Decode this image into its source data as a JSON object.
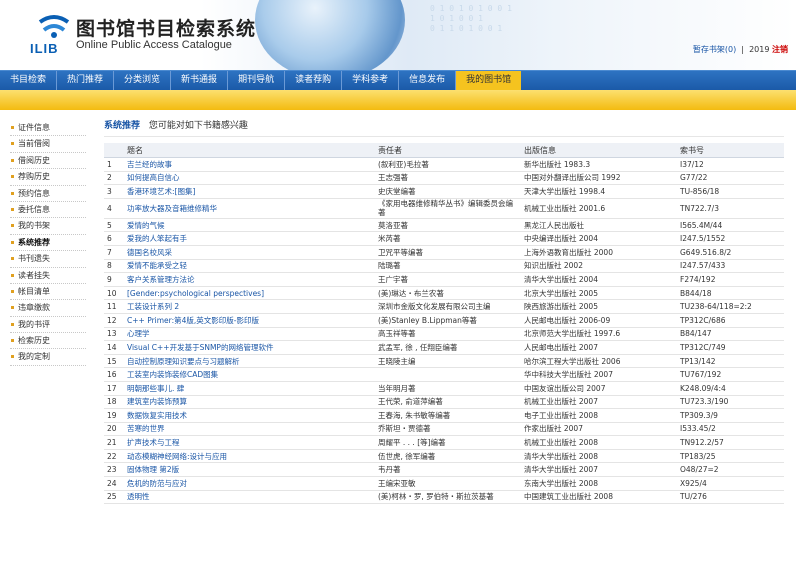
{
  "header": {
    "title_zh": "图书馆书目检索系统",
    "title_en": "Online Public Access Catalogue",
    "logo_text": "ILIB",
    "binary_text": "0 1 0 1 0 1 0 0 1\n1 0 1 0 0 1\n0 1 1 0 1 0 0 1",
    "shelf_label": "暂存书架",
    "shelf_count": "(0)",
    "user_id": "2019",
    "logout_label": "注销"
  },
  "nav": {
    "items": [
      "书目检索",
      "热门推荐",
      "分类浏览",
      "新书通报",
      "期刊导航",
      "读者荐购",
      "学科参考",
      "信息发布",
      "我的图书馆"
    ]
  },
  "sidebar": {
    "items": [
      "证件信息",
      "当前借阅",
      "借阅历史",
      "荐购历史",
      "预约信息",
      "委托信息",
      "我的书架",
      "系统推荐",
      "书刊遗失",
      "读者挂失",
      "帐目清单",
      "违章缴款",
      "我的书评",
      "检索历史",
      "我的定制"
    ],
    "active_index": 7
  },
  "main": {
    "heading": "系统推荐",
    "subheading": "您可能对如下书籍感兴趣"
  },
  "table": {
    "headers": [
      "",
      "题名",
      "责任者",
      "出版信息",
      "索书号"
    ],
    "rows": [
      [
        "1",
        "吉兰经的故事",
        "(叙利亚)毛拉著",
        "新华出版社 1983.3",
        "I37/12"
      ],
      [
        "2",
        "如何提高自信心",
        "王志强著",
        "中国对外翻译出版公司 1992",
        "G77/22"
      ],
      [
        "3",
        "香港环境艺术:[图集]",
        "史庆堂编著",
        "天津大学出版社 1998.4",
        "TU-856/18"
      ],
      [
        "4",
        "功率放大器及音箱维修精华",
        "《家用电器维修精华丛书》编辑委员会编著",
        "机械工业出版社 2001.6",
        "TN722.7/3"
      ],
      [
        "5",
        "爱情的气候",
        "莫洛亚著",
        "黑龙江人民出版社",
        "I565.4M/44"
      ],
      [
        "6",
        "爱我的人笨起有手",
        "米芮著",
        "中央编译出版社 2004",
        "I247.5/1552"
      ],
      [
        "7",
        "德国名校风采",
        "卫咒平等编著",
        "上海外语教育出版社 2000",
        "G649.516.8/2"
      ],
      [
        "8",
        "爱情不能承受之轻",
        "陆璐著",
        "知识出版社 2002",
        "I247.57/433"
      ],
      [
        "9",
        "客户关系管理方法论",
        "王广宇著",
        "清华大学出版社 2004",
        "F274/192"
      ],
      [
        "10",
        "[Gender:psychological perspectives]",
        "(美)琳达・布兰农著",
        "北京大学出版社 2005",
        "B844/18"
      ],
      [
        "11",
        "工装设计系列 2",
        "深圳市金版文化发展有限公司主编",
        "陕西旅游出版社 2005",
        "TU238-64/118=2:2"
      ],
      [
        "12",
        "C++ Primer:第4版,英文影印版-影印版",
        "(美)Stanley B.Lippman等著",
        "人民邮电出版社 2006-09",
        "TP312C/686"
      ],
      [
        "13",
        "心理学",
        "高玉祥等著",
        "北京师范大学出版社 1997.6",
        "B84/147"
      ],
      [
        "14",
        "Visual C++开发基于SNMP的网络管理软件",
        "武孟军, 徐 , 任翔臣编著",
        "人民邮电出版社 2007",
        "TP312C/749"
      ],
      [
        "15",
        "自动控制原理知识要点与习题解析",
        "王晓陵主编",
        "哈尔滨工程大学出版社 2006",
        "TP13/142"
      ],
      [
        "16",
        "工装室内装饰装修CAD图集",
        "",
        "华中科技大学出版社 2007",
        "TU767/192"
      ],
      [
        "17",
        "明朝那些事儿. 肆",
        "当年明月著",
        "中国友谊出版公司 2007",
        "K248.09/4:4"
      ],
      [
        "18",
        "建筑室内装饰预算",
        "王代荣, 俞道萍编著",
        "机械工业出版社 2007",
        "TU723.3/190"
      ],
      [
        "19",
        "数据恢复实用技术",
        "王春海, 朱书敏等编著",
        "电子工业出版社 2008",
        "TP309.3/9"
      ],
      [
        "20",
        "苦寒的世界",
        "乔斯坦・贾德著",
        "作家出版社 2007",
        "I533.45/2"
      ],
      [
        "21",
        "扩声技术与工程",
        "周耀平 . . . [等]编著",
        "机械工业出版社 2008",
        "TN912.2/57"
      ],
      [
        "22",
        "动态模糊神经网络:设计与应用",
        "伍世虎, 徐军编著",
        "清华大学出版社 2008",
        "TP183/25"
      ],
      [
        "23",
        "固体物理 第2版",
        "韦丹著",
        "清华大学出版社 2007",
        "O48/27=2"
      ],
      [
        "24",
        "危机的防范与应对",
        "王编宋亚敏",
        "东南大学出版社 2008",
        "X925/4"
      ],
      [
        "25",
        "透明性",
        "(美)柯林・罗, 罗伯特・斯拉茨基著",
        "中国建筑工业出版社 2008",
        "TU/276"
      ]
    ]
  }
}
